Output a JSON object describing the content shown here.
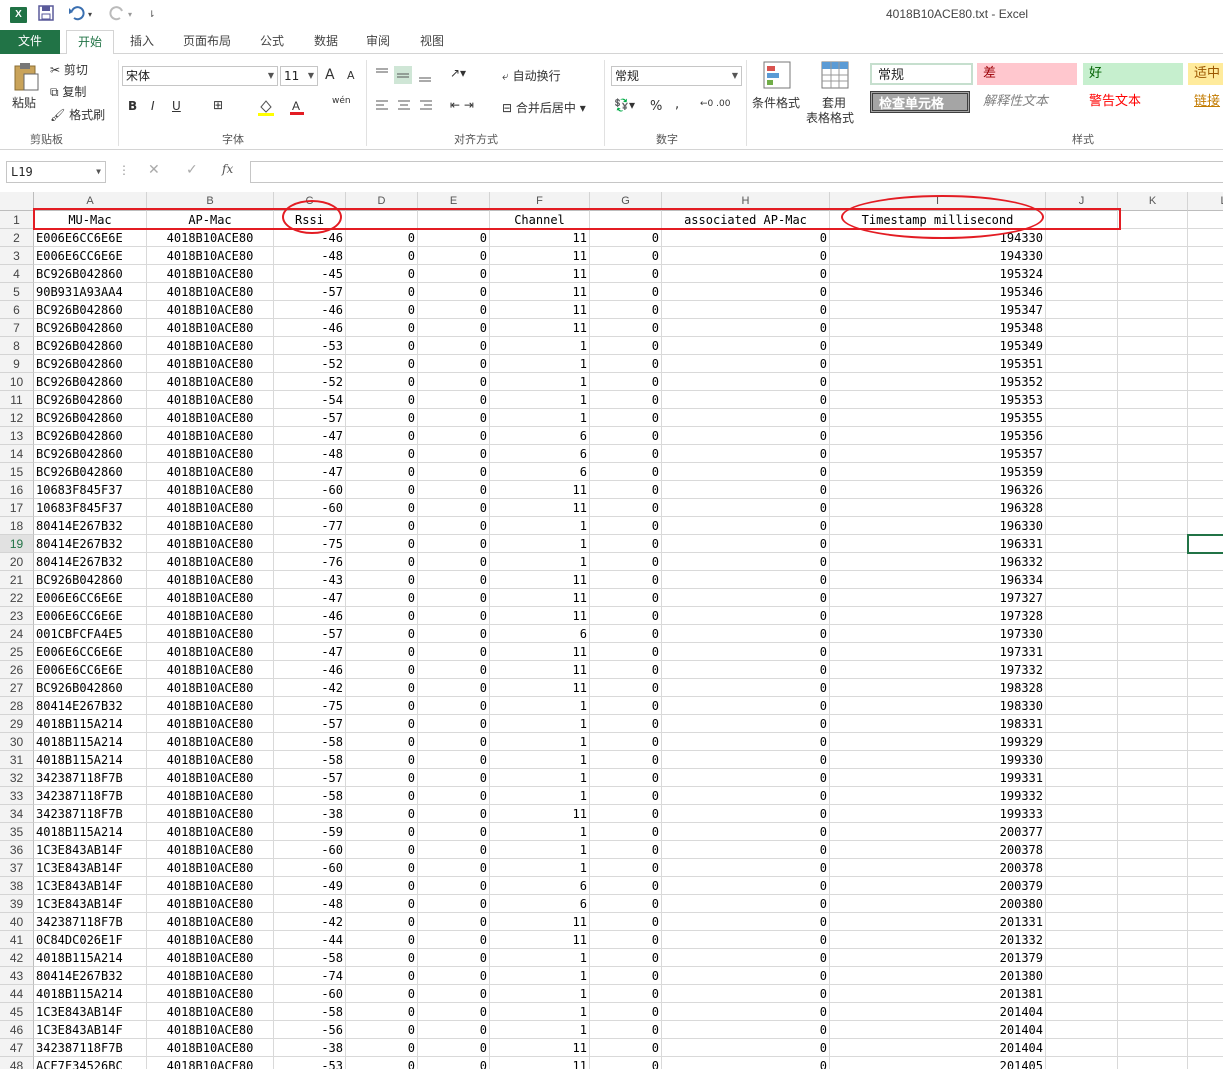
{
  "window": {
    "title": "4018B10ACE80.txt - Excel",
    "app_icon": "X"
  },
  "tabs": [
    "文件",
    "开始",
    "插入",
    "页面布局",
    "公式",
    "数据",
    "审阅",
    "视图"
  ],
  "ribbon": {
    "clipboard": {
      "paste": "粘贴",
      "cut": "剪切",
      "copy": "复制",
      "format_painter": "格式刷",
      "label": "剪贴板"
    },
    "font": {
      "name": "宋体",
      "size": "11",
      "bold": "B",
      "italic": "I",
      "underline": "U",
      "label": "字体",
      "grow": "A",
      "shrink": "A",
      "wen": "wén"
    },
    "align": {
      "wrap": "自动换行",
      "merge": "合并后居中",
      "label": "对齐方式"
    },
    "number": {
      "format": "常规",
      "percent": "%",
      "comma": ",",
      "label": "数字"
    },
    "styles_cmd": {
      "cond": "条件格式",
      "table_1": "套用",
      "table_2": "表格格式"
    },
    "styles": {
      "normal": "常规",
      "bad": "差",
      "good": "好",
      "neutral": "适中",
      "check": "检查单元格",
      "explain": "解释性文本",
      "warn": "警告文本",
      "link": "链接",
      "label": "样式"
    }
  },
  "formula_bar": {
    "name_box": "L19",
    "fx": "fx",
    "value": ""
  },
  "columns": [
    "A",
    "B",
    "C",
    "D",
    "E",
    "F",
    "G",
    "H",
    "I",
    "J",
    "K",
    "L"
  ],
  "header_row": [
    "MU-Mac",
    "AP-Mac",
    "Rssi",
    "",
    "",
    "Channel",
    "",
    "associated AP-Mac",
    "Timestamp millisecond"
  ],
  "rows": [
    [
      "E006E6CC6E6E",
      "4018B10ACE80",
      "-46",
      "0",
      "0",
      "11",
      "0",
      "0",
      "194330"
    ],
    [
      "E006E6CC6E6E",
      "4018B10ACE80",
      "-48",
      "0",
      "0",
      "11",
      "0",
      "0",
      "194330"
    ],
    [
      "BC926B042860",
      "4018B10ACE80",
      "-45",
      "0",
      "0",
      "11",
      "0",
      "0",
      "195324"
    ],
    [
      "90B931A93AA4",
      "4018B10ACE80",
      "-57",
      "0",
      "0",
      "11",
      "0",
      "0",
      "195346"
    ],
    [
      "BC926B042860",
      "4018B10ACE80",
      "-46",
      "0",
      "0",
      "11",
      "0",
      "0",
      "195347"
    ],
    [
      "BC926B042860",
      "4018B10ACE80",
      "-46",
      "0",
      "0",
      "11",
      "0",
      "0",
      "195348"
    ],
    [
      "BC926B042860",
      "4018B10ACE80",
      "-53",
      "0",
      "0",
      "1",
      "0",
      "0",
      "195349"
    ],
    [
      "BC926B042860",
      "4018B10ACE80",
      "-52",
      "0",
      "0",
      "1",
      "0",
      "0",
      "195351"
    ],
    [
      "BC926B042860",
      "4018B10ACE80",
      "-52",
      "0",
      "0",
      "1",
      "0",
      "0",
      "195352"
    ],
    [
      "BC926B042860",
      "4018B10ACE80",
      "-54",
      "0",
      "0",
      "1",
      "0",
      "0",
      "195353"
    ],
    [
      "BC926B042860",
      "4018B10ACE80",
      "-57",
      "0",
      "0",
      "1",
      "0",
      "0",
      "195355"
    ],
    [
      "BC926B042860",
      "4018B10ACE80",
      "-47",
      "0",
      "0",
      "6",
      "0",
      "0",
      "195356"
    ],
    [
      "BC926B042860",
      "4018B10ACE80",
      "-48",
      "0",
      "0",
      "6",
      "0",
      "0",
      "195357"
    ],
    [
      "BC926B042860",
      "4018B10ACE80",
      "-47",
      "0",
      "0",
      "6",
      "0",
      "0",
      "195359"
    ],
    [
      "10683F845F37",
      "4018B10ACE80",
      "-60",
      "0",
      "0",
      "11",
      "0",
      "0",
      "196326"
    ],
    [
      "10683F845F37",
      "4018B10ACE80",
      "-60",
      "0",
      "0",
      "11",
      "0",
      "0",
      "196328"
    ],
    [
      "80414E267B32",
      "4018B10ACE80",
      "-77",
      "0",
      "0",
      "1",
      "0",
      "0",
      "196330"
    ],
    [
      "80414E267B32",
      "4018B10ACE80",
      "-75",
      "0",
      "0",
      "1",
      "0",
      "0",
      "196331"
    ],
    [
      "80414E267B32",
      "4018B10ACE80",
      "-76",
      "0",
      "0",
      "1",
      "0",
      "0",
      "196332"
    ],
    [
      "BC926B042860",
      "4018B10ACE80",
      "-43",
      "0",
      "0",
      "11",
      "0",
      "0",
      "196334"
    ],
    [
      "E006E6CC6E6E",
      "4018B10ACE80",
      "-47",
      "0",
      "0",
      "11",
      "0",
      "0",
      "197327"
    ],
    [
      "E006E6CC6E6E",
      "4018B10ACE80",
      "-46",
      "0",
      "0",
      "11",
      "0",
      "0",
      "197328"
    ],
    [
      "001CBFCFA4E5",
      "4018B10ACE80",
      "-57",
      "0",
      "0",
      "6",
      "0",
      "0",
      "197330"
    ],
    [
      "E006E6CC6E6E",
      "4018B10ACE80",
      "-47",
      "0",
      "0",
      "11",
      "0",
      "0",
      "197331"
    ],
    [
      "E006E6CC6E6E",
      "4018B10ACE80",
      "-46",
      "0",
      "0",
      "11",
      "0",
      "0",
      "197332"
    ],
    [
      "BC926B042860",
      "4018B10ACE80",
      "-42",
      "0",
      "0",
      "11",
      "0",
      "0",
      "198328"
    ],
    [
      "80414E267B32",
      "4018B10ACE80",
      "-75",
      "0",
      "0",
      "1",
      "0",
      "0",
      "198330"
    ],
    [
      "4018B115A214",
      "4018B10ACE80",
      "-57",
      "0",
      "0",
      "1",
      "0",
      "0",
      "198331"
    ],
    [
      "4018B115A214",
      "4018B10ACE80",
      "-58",
      "0",
      "0",
      "1",
      "0",
      "0",
      "199329"
    ],
    [
      "4018B115A214",
      "4018B10ACE80",
      "-58",
      "0",
      "0",
      "1",
      "0",
      "0",
      "199330"
    ],
    [
      "342387118F7B",
      "4018B10ACE80",
      "-57",
      "0",
      "0",
      "1",
      "0",
      "0",
      "199331"
    ],
    [
      "342387118F7B",
      "4018B10ACE80",
      "-58",
      "0",
      "0",
      "1",
      "0",
      "0",
      "199332"
    ],
    [
      "342387118F7B",
      "4018B10ACE80",
      "-38",
      "0",
      "0",
      "11",
      "0",
      "0",
      "199333"
    ],
    [
      "4018B115A214",
      "4018B10ACE80",
      "-59",
      "0",
      "0",
      "1",
      "0",
      "0",
      "200377"
    ],
    [
      "1C3E843AB14F",
      "4018B10ACE80",
      "-60",
      "0",
      "0",
      "1",
      "0",
      "0",
      "200378"
    ],
    [
      "1C3E843AB14F",
      "4018B10ACE80",
      "-60",
      "0",
      "0",
      "1",
      "0",
      "0",
      "200378"
    ],
    [
      "1C3E843AB14F",
      "4018B10ACE80",
      "-49",
      "0",
      "0",
      "6",
      "0",
      "0",
      "200379"
    ],
    [
      "1C3E843AB14F",
      "4018B10ACE80",
      "-48",
      "0",
      "0",
      "6",
      "0",
      "0",
      "200380"
    ],
    [
      "342387118F7B",
      "4018B10ACE80",
      "-42",
      "0",
      "0",
      "11",
      "0",
      "0",
      "201331"
    ],
    [
      "0C84DC026E1F",
      "4018B10ACE80",
      "-44",
      "0",
      "0",
      "11",
      "0",
      "0",
      "201332"
    ],
    [
      "4018B115A214",
      "4018B10ACE80",
      "-58",
      "0",
      "0",
      "1",
      "0",
      "0",
      "201379"
    ],
    [
      "80414E267B32",
      "4018B10ACE80",
      "-74",
      "0",
      "0",
      "1",
      "0",
      "0",
      "201380"
    ],
    [
      "4018B115A214",
      "4018B10ACE80",
      "-60",
      "0",
      "0",
      "1",
      "0",
      "0",
      "201381"
    ],
    [
      "1C3E843AB14F",
      "4018B10ACE80",
      "-58",
      "0",
      "0",
      "1",
      "0",
      "0",
      "201404"
    ],
    [
      "1C3E843AB14F",
      "4018B10ACE80",
      "-56",
      "0",
      "0",
      "1",
      "0",
      "0",
      "201404"
    ],
    [
      "342387118F7B",
      "4018B10ACE80",
      "-38",
      "0",
      "0",
      "11",
      "0",
      "0",
      "201404"
    ],
    [
      "ACE7F34526BC",
      "4018B10ACE80",
      "-53",
      "0",
      "0",
      "11",
      "0",
      "0",
      "201405"
    ]
  ],
  "selected_row": 19,
  "colors": {
    "excel_green": "#217346",
    "annotation_red": "#e31c23"
  }
}
